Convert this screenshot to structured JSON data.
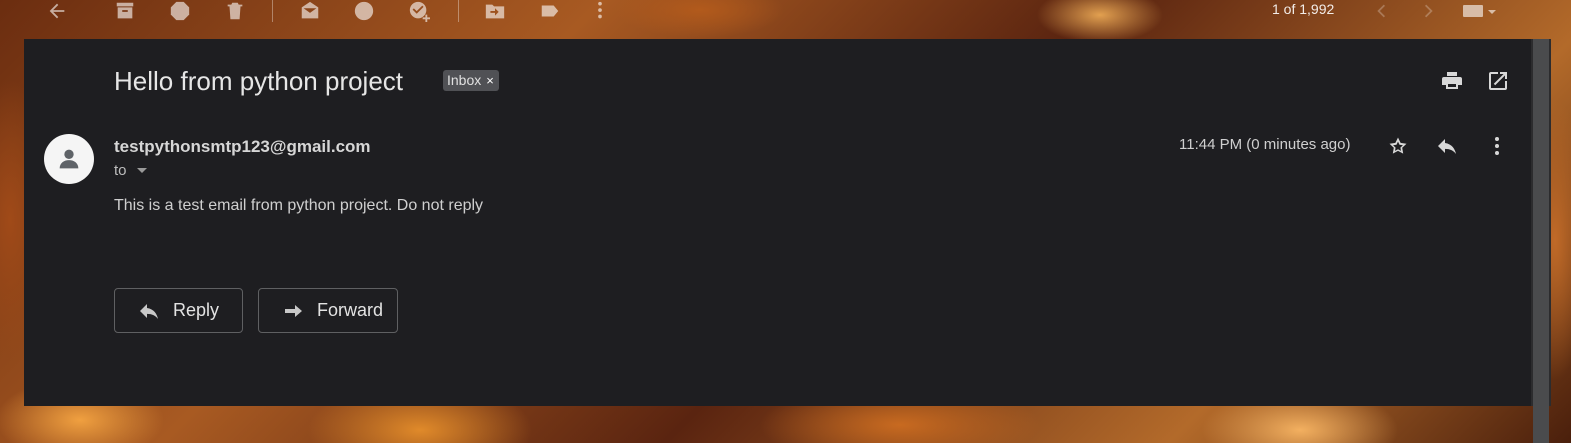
{
  "toolbar": {
    "icons": [
      "back-arrow-icon",
      "archive-icon",
      "report-spam-icon",
      "delete-icon",
      "mark-unread-icon",
      "snooze-icon",
      "add-task-icon",
      "move-to-icon",
      "label-icon",
      "more-vert-icon"
    ],
    "pager_text": "1 of 1,992"
  },
  "email": {
    "subject": "Hello from python project",
    "label": "Inbox",
    "label_remove": "×",
    "sender": "testpythonsmtp123@gmail.com",
    "to_label": "to",
    "timestamp": "11:44 PM (0 minutes ago)",
    "body": "This is a test email from python project. Do not reply"
  },
  "actions": {
    "reply_label": "Reply",
    "forward_label": "Forward"
  },
  "colors": {
    "panel_bg": "#1e1e21",
    "text_primary": "#e6e6e6",
    "chip_bg": "#505155"
  }
}
